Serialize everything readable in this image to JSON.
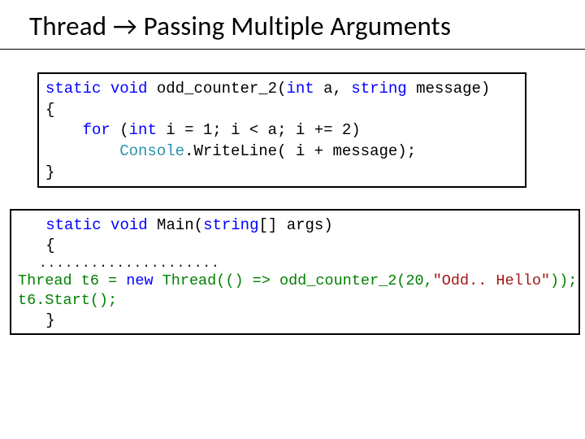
{
  "title": "Thread → Passing Multiple Arguments",
  "code1": {
    "sig_kw1": "static",
    "sig_kw2": "void",
    "sig_name": " odd_counter_2(",
    "sig_kw3": "int",
    "sig_mid": " a, ",
    "sig_kw4": "string",
    "sig_end": " message)",
    "brace_open": "{",
    "for_kw": "for",
    "for_open": " (",
    "for_int": "int",
    "for_rest": " i = 1; i < a; i += 2)",
    "console": "Console",
    "writeln": ".WriteLine( i + message);",
    "brace_close": "}",
    "indent_for": "    ",
    "indent_body": "        "
  },
  "code2": {
    "sig_kw1": "static",
    "sig_kw2": "void",
    "sig_name": " Main(",
    "sig_kw3": "string",
    "sig_end": "[] args)",
    "brace_open": "{",
    "dots": ".....................",
    "t6_a": "Thread t6 = ",
    "t6_new": "new",
    "t6_b": " Thread(() => odd_counter_2(20,",
    "t6_str": "\"Odd.. Hello\"",
    "t6_c": "));",
    "start": "t6.Start();",
    "brace_close": "}",
    "sig_pad": "   ",
    "brace_pad": "   ",
    "close_pad": "   "
  }
}
